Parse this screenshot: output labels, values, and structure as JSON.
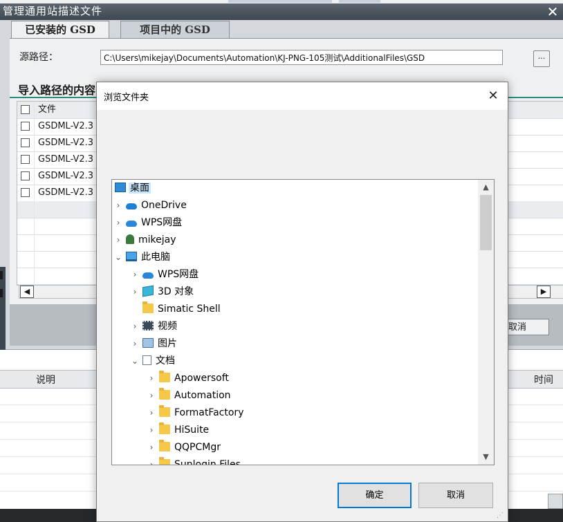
{
  "tia": {
    "title": "管理通用站描述文件",
    "tabs": [
      "已安装的 GSD",
      "项目中的 GSD"
    ],
    "source_path_label": "源路径：",
    "source_path_value": "C:\\Users\\mikejay\\Documents\\Automation\\KJ-PNG-105测试\\AdditionalFiles\\GSD",
    "browse_label": "...",
    "import_heading": "导入路径的内容",
    "file_column_header": "文件",
    "file_rows": [
      "GSDML-V2.3",
      "GSDML-V2.3",
      "GSDML-V2.3",
      "GSDML-V2.3",
      "GSDML-V2.3"
    ],
    "cancel_label": "取消",
    "close_glyph": "✕"
  },
  "info_table": {
    "col_description": "说明",
    "col_time": "时间"
  },
  "browse_dialog": {
    "title": "浏览文件夹",
    "close_glyph": "✕",
    "ok_label": "确定",
    "cancel_label": "取消",
    "tree": [
      {
        "label": "桌面",
        "icon": "desktop-icon",
        "chevron": "",
        "selected": true
      },
      {
        "label": "OneDrive",
        "icon": "onedrive-icon",
        "chevron": "›"
      },
      {
        "label": "WPS网盘",
        "icon": "wps-cloud-icon",
        "chevron": "›"
      },
      {
        "label": "mikejay",
        "icon": "user-icon",
        "chevron": "›"
      },
      {
        "label": "此电脑",
        "icon": "this-pc-icon",
        "chevron": "⌄"
      },
      {
        "label": "WPS网盘",
        "icon": "wps-cloud-icon",
        "chevron": "›"
      },
      {
        "label": "3D 对象",
        "icon": "3d-objects-icon",
        "chevron": "›"
      },
      {
        "label": "Simatic Shell",
        "icon": "folder-icon",
        "chevron": ""
      },
      {
        "label": "视频",
        "icon": "video-icon",
        "chevron": "›"
      },
      {
        "label": "图片",
        "icon": "pictures-icon",
        "chevron": "›"
      },
      {
        "label": "文档",
        "icon": "documents-icon",
        "chevron": "⌄"
      },
      {
        "label": "Apowersoft",
        "icon": "folder-icon",
        "chevron": "›"
      },
      {
        "label": "Automation",
        "icon": "folder-icon",
        "chevron": "›"
      },
      {
        "label": "FormatFactory",
        "icon": "folder-icon",
        "chevron": "›"
      },
      {
        "label": "HiSuite",
        "icon": "folder-icon",
        "chevron": "›"
      },
      {
        "label": "QQPCMgr",
        "icon": "folder-icon",
        "chevron": "›"
      },
      {
        "label": "Sunlogin Files",
        "icon": "folder-icon",
        "chevron": "›"
      }
    ]
  }
}
